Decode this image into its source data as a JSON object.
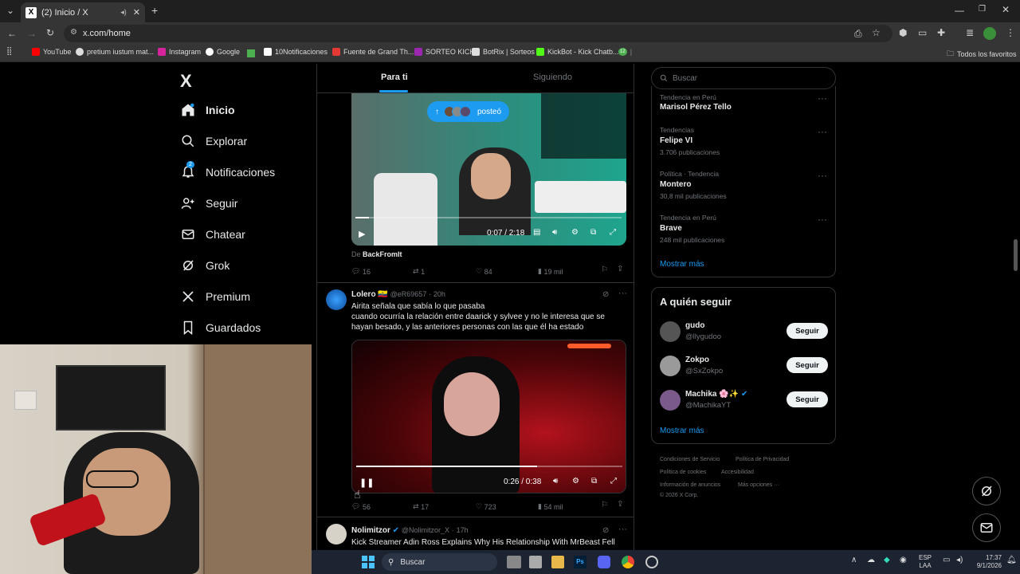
{
  "browser": {
    "tab_title": "(2) Inicio / X",
    "url": "x.com/home",
    "bookmarks": [
      "YouTube",
      "pretium iustum mat...",
      "Instagram",
      "Google",
      "10Notificaciones",
      "Fuente de Grand Th...",
      "SORTEO KICK",
      "BotRix | Sorteos",
      "KickBot - Kick Chatb...",
      "12"
    ],
    "all_bookmarks": "Todos los favoritos"
  },
  "nav": {
    "logo": "X",
    "items": [
      {
        "label": "Inicio",
        "icon": "home-icon"
      },
      {
        "label": "Explorar",
        "icon": "search-icon"
      },
      {
        "label": "Notificaciones",
        "icon": "bell-icon",
        "badge": "2"
      },
      {
        "label": "Seguir",
        "icon": "add-person-icon"
      },
      {
        "label": "Chatear",
        "icon": "mail-icon"
      },
      {
        "label": "Grok",
        "icon": "grok-icon"
      },
      {
        "label": "Premium",
        "icon": "x-logo-icon"
      },
      {
        "label": "Guardados",
        "icon": "bookmark-icon"
      }
    ]
  },
  "feed": {
    "tabs": [
      "Para ti",
      "Siguiendo"
    ],
    "posted_pill": "posteó",
    "video1": {
      "time": "0:07 / 2:18",
      "progress": 0.05,
      "source_prefix": "De",
      "source_name": "BackFromIt",
      "replies": "16",
      "reposts": "1",
      "likes": "84",
      "views": "19 mil"
    },
    "tweet2": {
      "name": "Lolero",
      "flag": "🇪🇨",
      "handle": "@eR69657",
      "time": "20h",
      "text_lines": [
        "Airita señala que sabía lo que pasaba",
        "cuando ocurría la relación entre daarick y sylvee  y no le interesa que se",
        "hayan besado, y las anteriores personas con las que él ha  estado"
      ],
      "video_time": "0:26 / 0:38",
      "progress": 0.68,
      "replies": "56",
      "reposts": "17",
      "likes": "723",
      "views": "54 mil"
    },
    "tweet3": {
      "name": "Nolimitzor",
      "handle": "@Nolimitzor_X",
      "time": "17h",
      "text": "Kick Streamer Adin Ross Explains Why His Relationship With MrBeast Fell"
    }
  },
  "sidebar": {
    "search_placeholder": "Buscar",
    "trends": [
      {
        "category": "Tendencia en Perú",
        "name": "Marisol Pérez Tello",
        "count": ""
      },
      {
        "category": "Tendencias",
        "name": "Felipe VI",
        "count": "3.706 publicaciones"
      },
      {
        "category": "Política · Tendencia",
        "name": "Montero",
        "count": "30,8 mil publicaciones"
      },
      {
        "category": "Tendencia en Perú",
        "name": "Brave",
        "count": "248 mil publicaciones"
      }
    ],
    "show_more": "Mostrar más",
    "who_to_follow_title": "A quién seguir",
    "follow": [
      {
        "name": "gudo",
        "handle": "@llygudoo",
        "button": "Seguir"
      },
      {
        "name": "Zokpo",
        "handle": "@SxZokpo",
        "button": "Seguir"
      },
      {
        "name": "Machika 🌸✨",
        "handle": "@MachikaYT",
        "button": "Seguir"
      }
    ],
    "show_more_2": "Mostrar más",
    "footer": [
      "Condiciones de Servicio",
      "Política de Privacidad",
      "Política de cookies",
      "Accesibilidad",
      "Información de anuncios",
      "Más opciones ···",
      "© 2026 X Corp."
    ]
  },
  "taskbar": {
    "search": "Buscar",
    "lang_top": "ESP",
    "lang_bottom": "LAA",
    "time": "17:37",
    "date": "9/1/2026"
  },
  "colors": {
    "accent": "#1d9bf0",
    "background": "#000000",
    "border": "#2f3336"
  }
}
